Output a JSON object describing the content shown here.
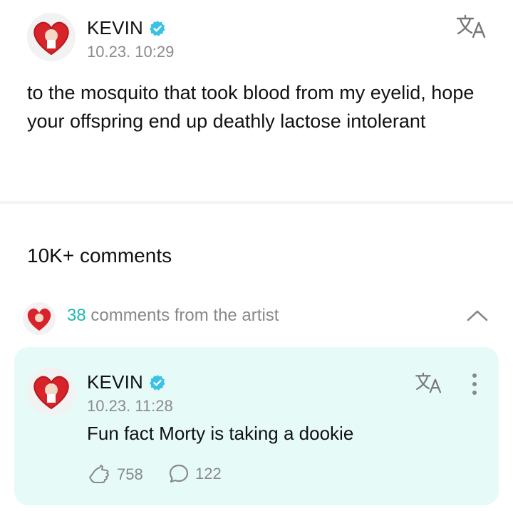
{
  "post": {
    "author": "KEVIN",
    "timestamp": "10.23. 10:29",
    "text": "to the mosquito that took blood from my eyelid, hope your offspring end up deathly lactose intolerant"
  },
  "comments": {
    "count_label": "10K+ comments",
    "artist_count": "38",
    "artist_label": " comments from the artist"
  },
  "artist_comment": {
    "author": "KEVIN",
    "timestamp": "10.23. 11:28",
    "text": "Fun fact Morty is taking a dookie",
    "likes": "758",
    "replies": "122"
  },
  "colors": {
    "accent": "#1cb8b0",
    "card_bg": "#e6fbf8",
    "verified": "#39c2e6",
    "muted": "#888888"
  },
  "icons": [
    "verified-badge-icon",
    "translate-icon",
    "more-vertical-icon",
    "chevron-up-icon",
    "like-hand-icon",
    "comment-bubble-icon"
  ]
}
